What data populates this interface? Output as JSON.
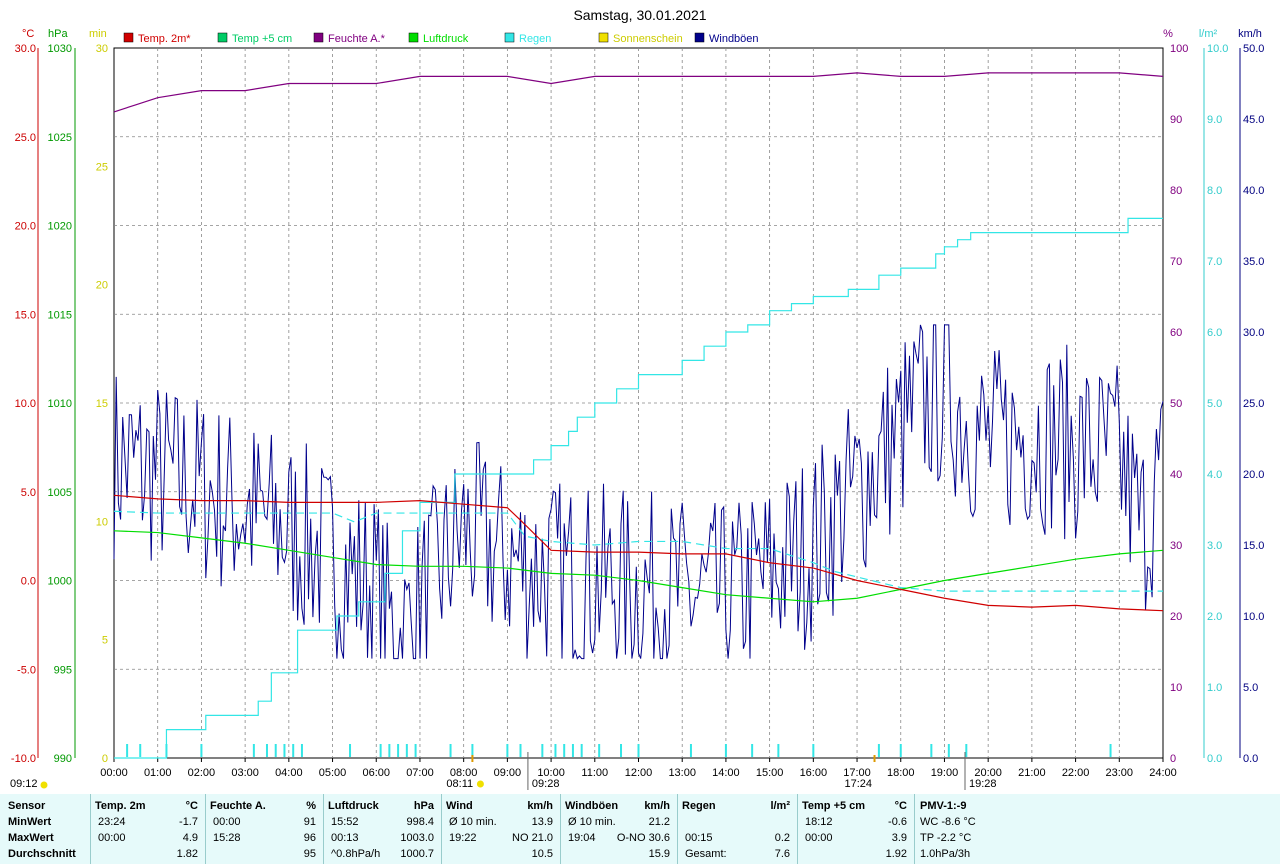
{
  "title": "Samstag, 30.01.2021",
  "colors": {
    "temp": "#d00000",
    "temp5": "#00cc66",
    "hum": "#800080",
    "press": "#00dd00",
    "rain": "#33e6e6",
    "sun": "#f0e000",
    "wind": "#00008b",
    "tempAxis": "#cc0000",
    "pressAxis": "#009900",
    "sunAxis": "#cccc00",
    "humAxis": "#800080",
    "rainAxis": "#33cccc",
    "windAxis": "#000080"
  },
  "axes": {
    "temp_unit": "°C",
    "press_unit": "hPa",
    "sun_unit": "min",
    "hum_unit": "%",
    "rain_unit": "l/m²",
    "wind_unit": "km/h",
    "temp_ticks": [
      "30.0",
      "25.0",
      "20.0",
      "15.0",
      "10.0",
      "5.0",
      "0.0",
      "-5.0",
      "-10.0"
    ],
    "press_ticks": [
      "1030",
      "1025",
      "1020",
      "1015",
      "1010",
      "1005",
      "1000",
      "995",
      "990"
    ],
    "sun_ticks": [
      "30",
      "25",
      "20",
      "15",
      "10",
      "5",
      "0"
    ],
    "hum_ticks": [
      "100",
      "90",
      "80",
      "70",
      "60",
      "50",
      "40",
      "30",
      "20",
      "10",
      "0"
    ],
    "rain_ticks": [
      "10.0",
      "9.0",
      "8.0",
      "7.0",
      "6.0",
      "5.0",
      "4.0",
      "3.0",
      "2.0",
      "1.0",
      "0.0"
    ],
    "wind_ticks": [
      "50.0",
      "45.0",
      "40.0",
      "35.0",
      "30.0",
      "25.0",
      "20.0",
      "15.0",
      "10.0",
      "5.0",
      "0.0"
    ],
    "x_ticks": [
      "00:00",
      "01:00",
      "02:00",
      "03:00",
      "04:00",
      "05:00",
      "06:00",
      "07:00",
      "08:00",
      "09:00",
      "10:00",
      "11:00",
      "12:00",
      "13:00",
      "14:00",
      "15:00",
      "16:00",
      "17:00",
      "18:00",
      "19:00",
      "20:00",
      "21:00",
      "22:00",
      "23:00",
      "24:00"
    ]
  },
  "legend": [
    "Temp. 2m*",
    "Temp +5 cm",
    "Feuchte A.*",
    "Luftdruck",
    "Regen",
    "Sonnenschein",
    "Windböen"
  ],
  "sun_times": {
    "rise": "08:11",
    "transit": "09:28",
    "set": "17:24",
    "moon": "19:28",
    "left": "09:12"
  },
  "chart_data": {
    "type": "line",
    "x_range": [
      "00:00",
      "24:00"
    ],
    "series": [
      {
        "name": "Temp. 2m*",
        "unit": "°C",
        "x": [
          0,
          1,
          2,
          3,
          4,
          5,
          6,
          7,
          8,
          9,
          9.3,
          10,
          11,
          12,
          13,
          14,
          15,
          16,
          17,
          18,
          19,
          20,
          21,
          22,
          23,
          24
        ],
        "values": [
          4.8,
          4.6,
          4.5,
          4.5,
          4.4,
          4.4,
          4.4,
          4.5,
          4.3,
          4.1,
          3.4,
          1.7,
          1.6,
          1.6,
          1.5,
          1.5,
          1.0,
          0.7,
          0.0,
          -0.5,
          -1.0,
          -1.4,
          -1.5,
          -1.4,
          -1.6,
          -1.7
        ]
      },
      {
        "name": "Temp +5 cm",
        "unit": "°C",
        "x": [
          0,
          1,
          2,
          3,
          4,
          5,
          5.5,
          6,
          7,
          8,
          9,
          9.4,
          10,
          11,
          12,
          13,
          14,
          15,
          16,
          16.5,
          17,
          18,
          19,
          20,
          21,
          22,
          23,
          24
        ],
        "values": [
          3.9,
          3.8,
          3.8,
          3.8,
          3.8,
          3.8,
          3.3,
          3.8,
          3.8,
          3.8,
          3.8,
          2.5,
          2.2,
          2.0,
          2.2,
          2.2,
          1.8,
          1.8,
          1.0,
          0.5,
          0.2,
          -0.4,
          -0.6,
          -0.6,
          -0.6,
          -0.6,
          -0.6,
          -0.6
        ]
      },
      {
        "name": "Feuchte A.*",
        "unit": "%",
        "x": [
          0,
          0.5,
          1,
          2,
          3,
          4,
          5,
          6,
          7,
          8,
          9,
          10,
          11,
          12,
          13,
          14,
          15,
          16,
          17,
          18,
          19,
          20,
          21,
          22,
          23,
          24
        ],
        "values": [
          91,
          92,
          93,
          94,
          94,
          95,
          95,
          95,
          96,
          96,
          96,
          95,
          96,
          96,
          96,
          96,
          96,
          96,
          96.5,
          96,
          96,
          96.5,
          96.5,
          96.5,
          96.5,
          96
        ]
      },
      {
        "name": "Luftdruck",
        "unit": "hPa",
        "x": [
          0,
          1,
          2,
          3,
          4,
          5,
          6,
          7,
          8,
          9,
          10,
          11,
          12,
          13,
          14,
          15,
          16,
          17,
          18,
          19,
          20,
          21,
          22,
          23,
          24
        ],
        "values": [
          1002.8,
          1002.7,
          1002.4,
          1002.1,
          1001.7,
          1001.3,
          1000.9,
          1000.8,
          1000.8,
          1000.7,
          1000.4,
          1000.3,
          1000.0,
          999.6,
          999.2,
          999.0,
          998.8,
          999.0,
          999.5,
          1000.0,
          1000.4,
          1000.8,
          1001.2,
          1001.5,
          1001.7
        ]
      },
      {
        "name": "Regen",
        "unit": "l/m²",
        "x": [
          0,
          0.6,
          1.2,
          2.1,
          3.3,
          3.6,
          4.2,
          5.1,
          5.6,
          6.2,
          6.6,
          7.0,
          7.8,
          8.6,
          9.2,
          9.6,
          10.0,
          10.4,
          10.6,
          11.0,
          11.5,
          12.0,
          13.0,
          13.5,
          14.0,
          14.5,
          15.0,
          15.5,
          16.0,
          16.8,
          17.5,
          18.0,
          18.8,
          19.0,
          19.3,
          19.6,
          20.0,
          21.0,
          22.0,
          22.9,
          23.2,
          24.0
        ],
        "values": [
          0.0,
          0.0,
          0.4,
          0.6,
          0.8,
          1.2,
          1.8,
          2.0,
          2.2,
          2.6,
          3.2,
          3.6,
          4.0,
          4.0,
          4.0,
          4.2,
          4.4,
          4.6,
          4.8,
          5.0,
          5.2,
          5.4,
          5.6,
          5.8,
          6.0,
          6.1,
          6.3,
          6.4,
          6.5,
          6.6,
          6.8,
          6.9,
          7.1,
          7.2,
          7.3,
          7.4,
          7.4,
          7.4,
          7.4,
          7.4,
          7.6,
          7.6
        ]
      },
      {
        "name": "Sonnenschein",
        "unit": "min",
        "x": [
          0,
          24
        ],
        "values": [
          0,
          0
        ]
      },
      {
        "name": "Windböen",
        "unit": "km/h",
        "x": [
          0,
          2,
          4,
          6,
          6.5,
          8,
          9,
          10,
          12,
          14,
          16,
          18,
          18.5,
          19,
          20,
          21,
          22,
          23,
          23.5,
          24
        ],
        "values": [
          21,
          19,
          16,
          12,
          8,
          16,
          14,
          13,
          12,
          11,
          15,
          23,
          25,
          26,
          22,
          23,
          22,
          21,
          16,
          20
        ]
      }
    ]
  },
  "table": {
    "headers": {
      "sensor": "Sensor",
      "temp": "Temp. 2m",
      "temp_u": "°C",
      "hum": "Feuchte A.",
      "hum_u": "%",
      "press": "Luftdruck",
      "press_u": "hPa",
      "wind": "Wind",
      "wind_u": "km/h",
      "gust": "Windböen",
      "gust_u": "km/h",
      "rain": "Regen",
      "rain_u": "l/m²",
      "temp5": "Temp +5 cm",
      "temp5_u": "°C",
      "pmv": "PMV-1:-9"
    },
    "rows": [
      {
        "label": "MinWert",
        "temp_t": "23:24",
        "temp_v": "-1.7",
        "hum_t": "00:00",
        "hum_v": "91",
        "press_t": "15:52",
        "press_v": "998.4",
        "wind_t": "Ø 10 min.",
        "wind_v": "13.9",
        "gust_t": "Ø 10 min.",
        "gust_v": "21.2",
        "rain_t": "",
        "rain_v": "",
        "temp5_t": "18:12",
        "temp5_v": "-0.6",
        "pmv": "WC -8.6 °C"
      },
      {
        "label": "MaxWert",
        "temp_t": "00:00",
        "temp_v": "4.9",
        "hum_t": "15:28",
        "hum_v": "96",
        "press_t": "00:13",
        "press_v": "1003.0",
        "wind_t": "19:22",
        "wind_v": "NO 21.0",
        "gust_t": "19:04",
        "gust_v": "O-NO 30.6",
        "rain_t": "00:15",
        "rain_v": "0.2",
        "temp5_t": "00:00",
        "temp5_v": "3.9",
        "pmv": "TP -2.2 °C"
      },
      {
        "label": "Durchschnitt",
        "temp_t": "",
        "temp_v": "1.82",
        "hum_t": "",
        "hum_v": "95",
        "press_t": "^0.8hPa/h",
        "press_v": "1000.7",
        "wind_t": "",
        "wind_v": "10.5",
        "gust_t": "",
        "gust_v": "15.9",
        "rain_t": "Gesamt:",
        "rain_v": "7.6",
        "temp5_t": "",
        "temp5_v": "1.92",
        "pmv": "1.0hPa/3h"
      }
    ]
  }
}
